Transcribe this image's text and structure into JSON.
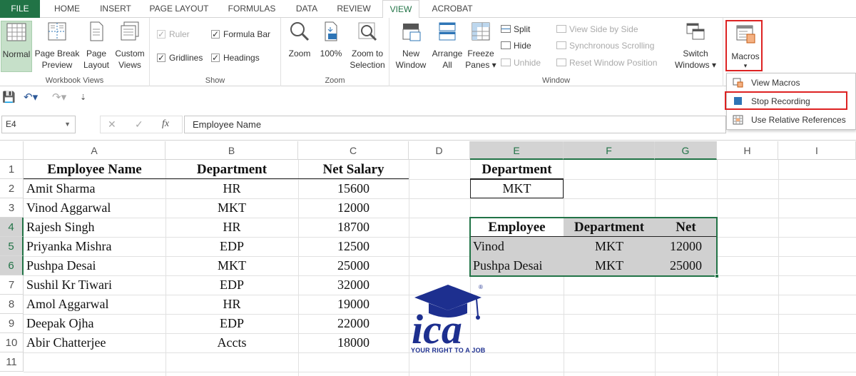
{
  "tabs": [
    "FILE",
    "HOME",
    "INSERT",
    "PAGE LAYOUT",
    "FORMULAS",
    "DATA",
    "REVIEW",
    "VIEW",
    "ACROBAT"
  ],
  "ribbon": {
    "workbook_views": {
      "label": "Workbook Views",
      "normal": "Normal",
      "page_break_1": "Page Break",
      "page_break_2": "Preview",
      "page_layout_1": "Page",
      "page_layout_2": "Layout",
      "custom_views_1": "Custom",
      "custom_views_2": "Views"
    },
    "show": {
      "label": "Show",
      "ruler": "Ruler",
      "formula_bar": "Formula Bar",
      "gridlines": "Gridlines",
      "headings": "Headings"
    },
    "zoom": {
      "label": "Zoom",
      "zoom": "Zoom",
      "hundred": "100%",
      "zoom_sel_1": "Zoom to",
      "zoom_sel_2": "Selection"
    },
    "window": {
      "label": "Window",
      "new_1": "New",
      "new_2": "Window",
      "arrange_1": "Arrange",
      "arrange_2": "All",
      "freeze_1": "Freeze",
      "freeze_2": "Panes ▾",
      "split": "Split",
      "hide": "Hide",
      "unhide": "Unhide",
      "side_by_side": "View Side by Side",
      "sync_scroll": "Synchronous Scrolling",
      "reset_pos": "Reset Window Position",
      "switch_1": "Switch",
      "switch_2": "Windows ▾"
    },
    "macros": {
      "label": "Macros",
      "caret": "▾"
    }
  },
  "macro_menu": {
    "view_macros": "View Macros",
    "stop_recording": "Stop Recording",
    "relative_refs": "Use Relative References"
  },
  "formula_bar": {
    "name_box": "E4",
    "fx": "fx",
    "value": "Employee Name"
  },
  "sheet": {
    "columns": [
      "A",
      "B",
      "C",
      "D",
      "E",
      "F",
      "G",
      "H",
      "I"
    ],
    "rows": [
      "1",
      "2",
      "3",
      "4",
      "5",
      "6",
      "7",
      "8",
      "9",
      "10",
      "11"
    ],
    "main_headers": {
      "name": "Employee Name",
      "dept": "Department",
      "salary": "Net Salary"
    },
    "employees": [
      {
        "name": "Amit Sharma",
        "dept": "HR",
        "salary": "15600"
      },
      {
        "name": "Vinod Aggarwal",
        "dept": "MKT",
        "salary": "12000"
      },
      {
        "name": "Rajesh Singh",
        "dept": "HR",
        "salary": "18700"
      },
      {
        "name": "Priyanka Mishra",
        "dept": "EDP",
        "salary": "12500"
      },
      {
        "name": "Pushpa Desai",
        "dept": "MKT",
        "salary": "25000"
      },
      {
        "name": "Sushil Kr Tiwari",
        "dept": "EDP",
        "salary": "32000"
      },
      {
        "name": "Amol Aggarwal",
        "dept": "HR",
        "salary": "19000"
      },
      {
        "name": "Deepak Ojha",
        "dept": "EDP",
        "salary": "22000"
      },
      {
        "name": "Abir Chatterjee",
        "dept": "Accts",
        "salary": "18000"
      }
    ],
    "criteria": {
      "header": "Department",
      "value": "MKT"
    },
    "result_headers": {
      "emp": "Employee",
      "dept": "Department",
      "net": "Net"
    },
    "results": [
      {
        "emp": "Vinod",
        "dept": "MKT",
        "net": "12000"
      },
      {
        "emp": "Pushpa Desai",
        "dept": "MKT",
        "net": "25000"
      }
    ]
  },
  "logo": {
    "tagline": "YOUR RIGHT TO A JOB",
    "mark": "ica"
  },
  "colors": {
    "excel_green": "#217346",
    "highlight_red": "#dd2222",
    "logo_blue": "#1d2f8f"
  }
}
